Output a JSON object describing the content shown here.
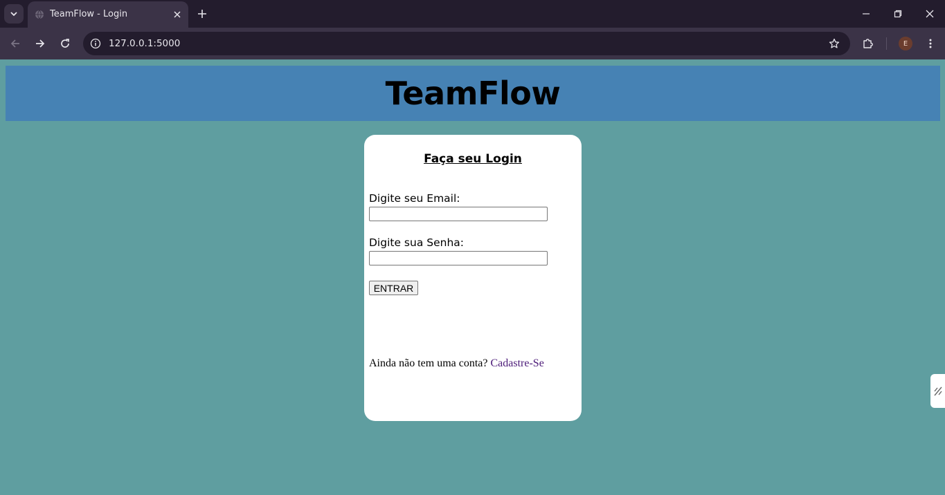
{
  "browser": {
    "tab_title": "TeamFlow - Login",
    "url": "127.0.0.1:5000",
    "profile_initial": "E"
  },
  "icons": {
    "tab_menu": "chevron-down-icon",
    "favicon": "globe-icon",
    "tab_close": "close-icon",
    "new_tab": "plus-icon",
    "back": "arrow-left-icon",
    "forward": "arrow-right-icon",
    "reload": "reload-icon",
    "site_info": "info-icon",
    "bookmark": "star-icon",
    "extensions": "puzzle-icon",
    "menu": "kebab-menu-icon",
    "minimize": "minimize-icon",
    "restore": "restore-icon",
    "close_window": "close-icon",
    "side_panel": "side-panel-icon"
  },
  "page": {
    "header_title": "TeamFlow",
    "login": {
      "title": "Faça seu Login",
      "email_label": "Digite seu Email:",
      "email_value": "",
      "password_label": "Digite sua Senha:",
      "password_value": "",
      "submit_label": "ENTRAR",
      "signup_prompt": "Ainda não tem uma conta?",
      "signup_link": "Cadastre-Se"
    }
  },
  "colors": {
    "page_bg": "#5f9ea0",
    "header_bg": "#4682b4",
    "card_bg": "#ffffff",
    "link": "#4b1a78"
  }
}
